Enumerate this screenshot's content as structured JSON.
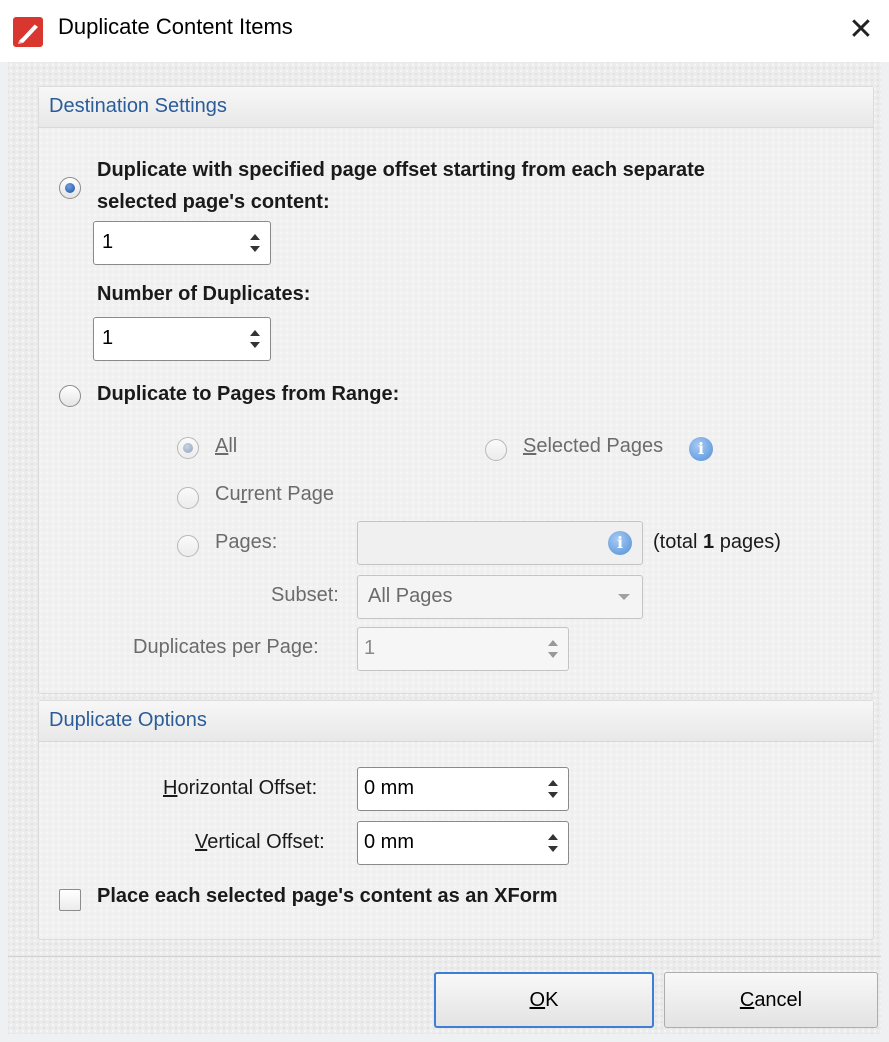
{
  "window": {
    "title": "Duplicate Content Items",
    "close_glyph": "✕",
    "app_icon": "pdf-pen-app-icon"
  },
  "destination": {
    "group_title": "Destination Settings",
    "offset_option": {
      "label_line1": "Duplicate with specified page offset starting from each separate",
      "label_line2": "selected page's content:",
      "selected": true,
      "page_offset_value": "1",
      "number_of_duplicates_label": "Number of Duplicates:",
      "number_of_duplicates_value": "1"
    },
    "range_option": {
      "label": "Duplicate to Pages from Range:",
      "selected": false,
      "all_label_mnemonic": "A",
      "all_label_rest": "ll",
      "all_selected": true,
      "selected_pages_label_mnemonic": "S",
      "selected_pages_label_rest": "elected Pages",
      "current_page_label_pre": "Cu",
      "current_page_label_mnemonic": "r",
      "current_page_label_rest": "rent Page",
      "pages_label": "Pages:",
      "pages_value": "",
      "total_pre": "(total ",
      "total_count": "1",
      "total_post": " pages)",
      "subset_label": "Subset:",
      "subset_value": "All Pages",
      "duplicates_per_page_label": "Duplicates per Page:",
      "duplicates_per_page_value": "1"
    }
  },
  "options": {
    "group_title": "Duplicate Options",
    "horizontal_offset_mnemonic": "H",
    "horizontal_offset_rest": "orizontal Offset:",
    "horizontal_offset_value": "0 mm",
    "vertical_offset_mnemonic": "V",
    "vertical_offset_rest": "ertical Offset:",
    "vertical_offset_value": "0 mm",
    "xform_label": "Place each selected page's content as an XForm",
    "xform_checked": false
  },
  "buttons": {
    "ok_mnemonic": "O",
    "ok_rest": "K",
    "cancel_mnemonic": "C",
    "cancel_rest": "ancel"
  },
  "colors": {
    "accent": "#1b4f9c",
    "group_title": "#2b5c9a",
    "default_button_border": "#3c7fd4",
    "info_icon": "#4f8fd8"
  }
}
